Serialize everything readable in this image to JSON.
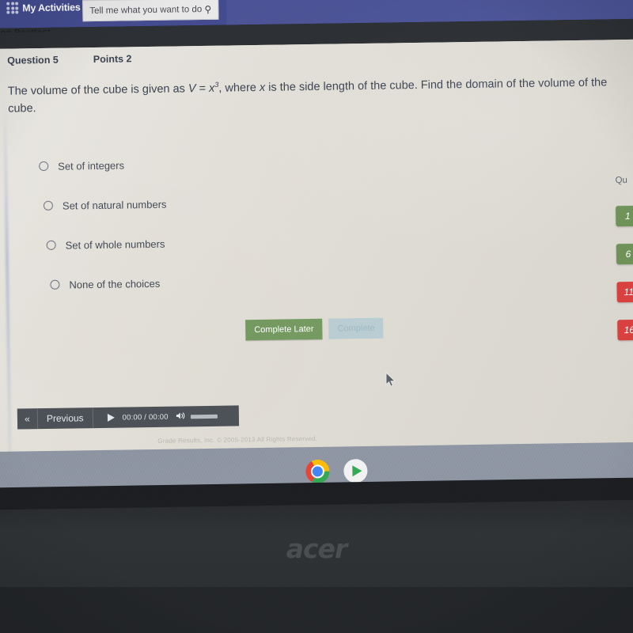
{
  "appbar": {
    "activities_label": "My Activities",
    "activities_icon": "grid-dots-icon",
    "search_placeholder": "Tell me what you want to do",
    "search_icon": "search-icon",
    "cut_off_text": "on Posttest"
  },
  "question": {
    "number_label": "Question 5",
    "points_label": "Points 2",
    "text_part1": "The volume of the cube is given as ",
    "formula_v": "V",
    "formula_eq": " = ",
    "formula_x": "x",
    "formula_exp": "3",
    "text_part2": ", where ",
    "formula_x2": "x",
    "text_part3": " is the side length of the cube. Find the domain of the volume of the cube.",
    "choices": [
      {
        "label": "Set of integers",
        "selected": false
      },
      {
        "label": "Set of natural numbers",
        "selected": false
      },
      {
        "label": "Set of whole numbers",
        "selected": false
      },
      {
        "label": "None of the choices",
        "selected": false
      }
    ]
  },
  "actions": {
    "complete_later_label": "Complete Later",
    "complete_label": "Complete",
    "complete_later_color": "#769b62",
    "complete_color": "#b9cdd3"
  },
  "navigator": {
    "title": "Qu",
    "tiles": [
      {
        "label": "1",
        "color": "#6e9158"
      },
      {
        "label": "6",
        "color": "#6e9158"
      },
      {
        "label": "11",
        "color": "#d94040"
      },
      {
        "label": "16",
        "color": "#d94040"
      }
    ]
  },
  "player": {
    "collapse_icon": "double-chevron-left-icon",
    "collapse_label": "«",
    "previous_label": "Previous",
    "play_icon": "play-icon",
    "time_elapsed": "00:00",
    "time_separator": "/",
    "time_total": "00:00",
    "speaker_icon": "speaker-icon",
    "speaker_glyph": "🔊"
  },
  "footer": {
    "copyright": "Grade Results, Inc. © 2005-2013 All Rights Reserved."
  },
  "shelf": {
    "icons": [
      {
        "name": "chrome-icon",
        "active": true
      },
      {
        "name": "google-play-icon",
        "active": false
      }
    ]
  },
  "device": {
    "brand": "acer"
  }
}
